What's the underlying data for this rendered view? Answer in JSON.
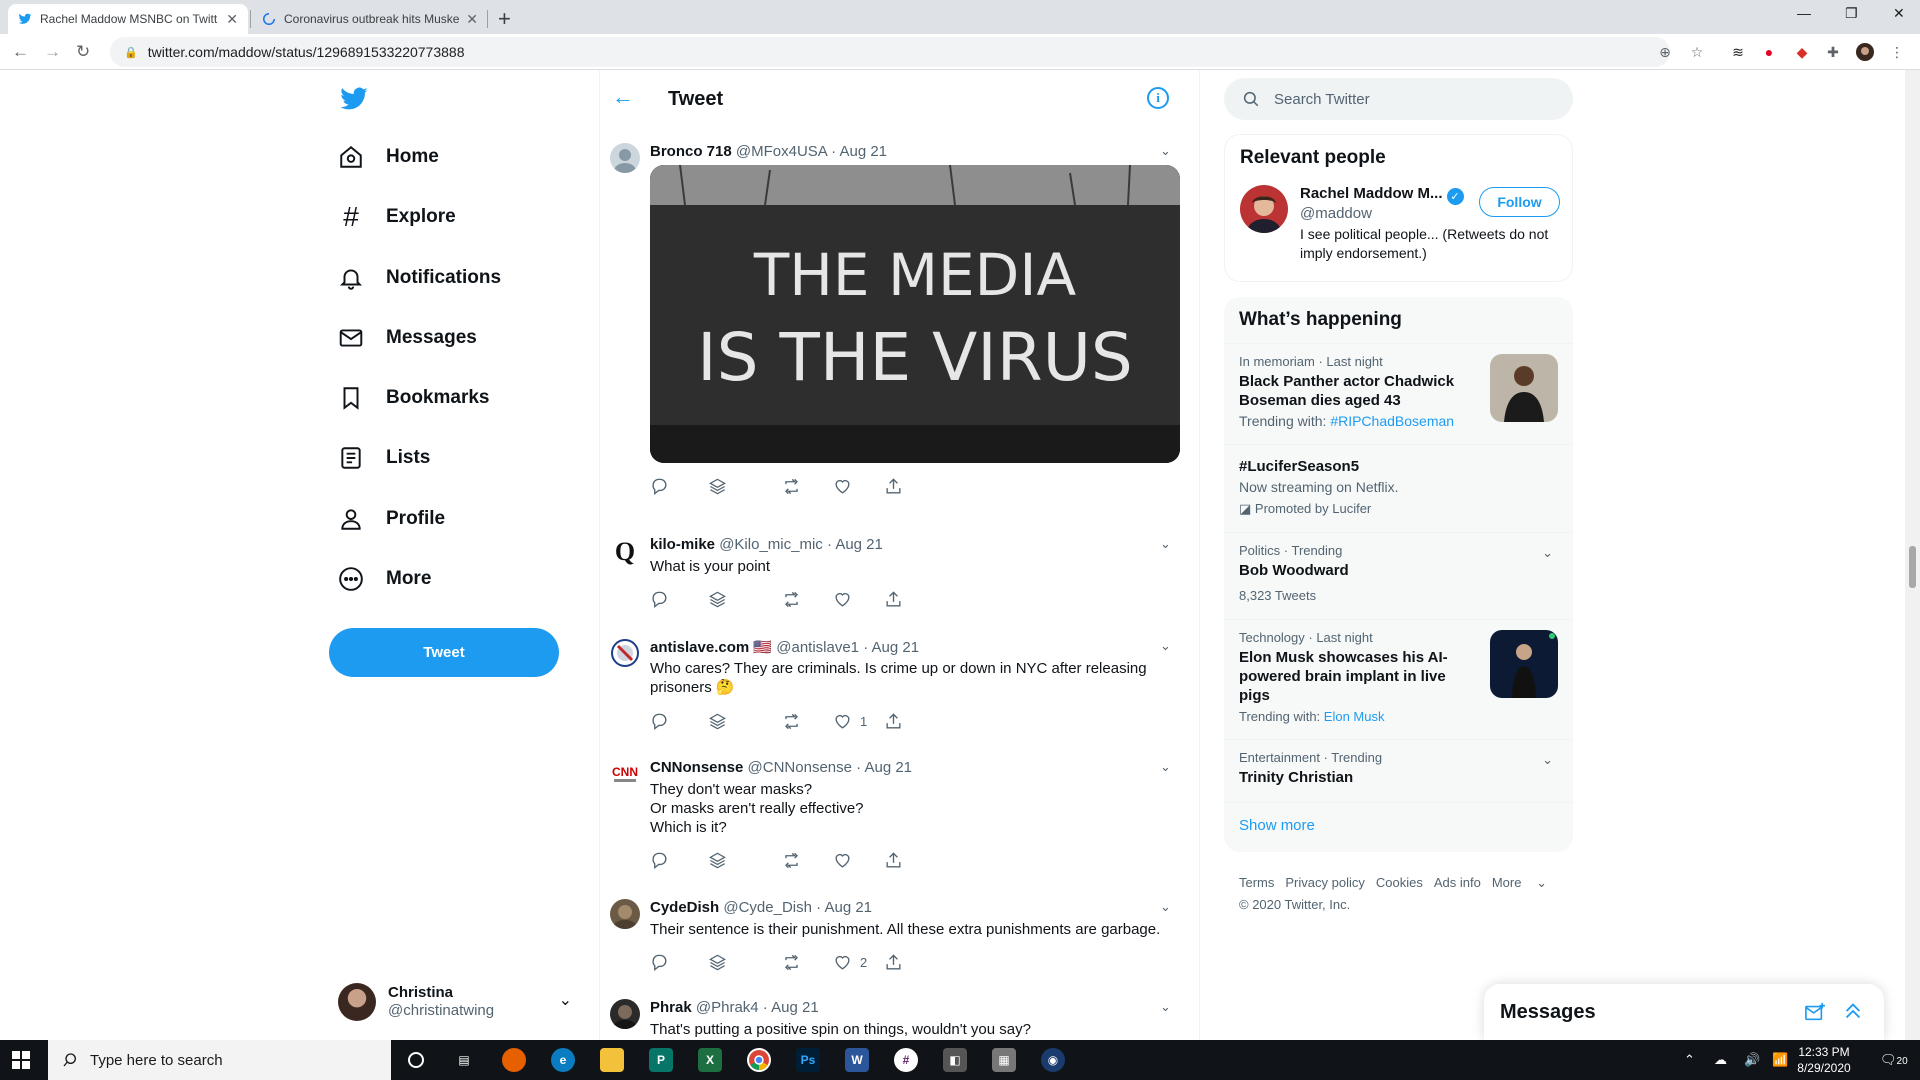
{
  "browser": {
    "tabs": [
      {
        "title": "Rachel Maddow MSNBC on Twitt",
        "active": true
      },
      {
        "title": "Coronavirus outbreak hits Muske",
        "active": false
      }
    ],
    "url": "twitter.com/maddow/status/1296891533220773888"
  },
  "nav": {
    "items": [
      {
        "label": "Home",
        "icon": "home-icon"
      },
      {
        "label": "Explore",
        "icon": "hashtag-icon"
      },
      {
        "label": "Notifications",
        "icon": "bell-icon"
      },
      {
        "label": "Messages",
        "icon": "envelope-icon"
      },
      {
        "label": "Bookmarks",
        "icon": "bookmark-icon"
      },
      {
        "label": "Lists",
        "icon": "list-icon"
      },
      {
        "label": "Profile",
        "icon": "person-icon"
      },
      {
        "label": "More",
        "icon": "more-circle-icon"
      }
    ],
    "tweet_button": "Tweet",
    "account": {
      "name": "Christina",
      "handle": "@christinatwing"
    }
  },
  "header": {
    "title": "Tweet"
  },
  "replies": [
    {
      "name": "Bronco 718",
      "handle": "@MFox4USA",
      "date": "Aug 21",
      "lines": [],
      "likes": "",
      "media_text": [
        "THE MEDIA",
        "IS THE VIRUS"
      ]
    },
    {
      "name": "kilo-mike",
      "handle": "@Kilo_mic_mic",
      "date": "Aug 21",
      "lines": [
        "What is your point"
      ],
      "likes": ""
    },
    {
      "name": "antislave.com",
      "handle": "@antislave1",
      "date": "Aug 21",
      "lines": [
        "Who cares? They are criminals. Is crime up or down in NYC after releasing",
        "prisoners 🤔"
      ],
      "likes": "1"
    },
    {
      "name": "CNNonsense",
      "handle": "@CNNonsense",
      "date": "Aug 21",
      "lines": [
        "They don't wear masks?",
        "Or masks aren't really effective?",
        "Which is it?"
      ],
      "likes": ""
    },
    {
      "name": "CydeDish",
      "handle": "@Cyde_Dish",
      "date": "Aug 21",
      "lines": [
        "Their sentence is their punishment. All these extra punishments are garbage."
      ],
      "likes": "2"
    },
    {
      "name": "Phrak",
      "handle": "@Phrak4",
      "date": "Aug 21",
      "lines": [
        "That's putting a positive spin on things, wouldn't you say?"
      ],
      "likes": ""
    }
  ],
  "search": {
    "placeholder": "Search Twitter"
  },
  "relevant_people": {
    "title": "Relevant people",
    "name": "Rachel Maddow M...",
    "handle": "@maddow",
    "bio": "I see political people... (Retweets do not imply endorsement.)",
    "follow_label": "Follow"
  },
  "happening": {
    "title": "What’s happening",
    "trends": [
      {
        "meta": "In memoriam · Last night",
        "title": "Black Panther actor Chadwick Boseman dies aged 43",
        "sub_prefix": "Trending with: ",
        "sub_link": "#RIPChadBoseman",
        "thumb": true
      },
      {
        "meta": "",
        "title": "#LuciferSeason5",
        "sub_prefix": "Now streaming on Netflix.",
        "sub_link": "",
        "promo": "Promoted by Lucifer",
        "thumb": false
      },
      {
        "meta": "Politics · Trending",
        "title": "Bob Woodward",
        "sub_prefix": "8,323 Tweets",
        "sub_link": "",
        "chevron": true
      },
      {
        "meta": "Technology · Last night",
        "title": "Elon Musk showcases his AI-powered brain implant in live pigs",
        "sub_prefix": "Trending with: ",
        "sub_link": "Elon Musk",
        "thumb": true
      },
      {
        "meta": "Entertainment · Trending",
        "title": "Trinity Christian",
        "sub_prefix": "",
        "sub_link": "",
        "chevron": true
      }
    ],
    "show_more": "Show more"
  },
  "footer": {
    "links": [
      "Terms",
      "Privacy policy",
      "Cookies",
      "Ads info",
      "More"
    ],
    "copyright": "© 2020 Twitter, Inc."
  },
  "messages_drawer": {
    "title": "Messages"
  },
  "taskbar": {
    "search_placeholder": "Type here to search",
    "time": "12:33 PM",
    "date": "8/29/2020",
    "notification_count": "20"
  },
  "colors": {
    "accent": "#1d9bf0",
    "text": "#0f1419",
    "muted": "#536471"
  }
}
